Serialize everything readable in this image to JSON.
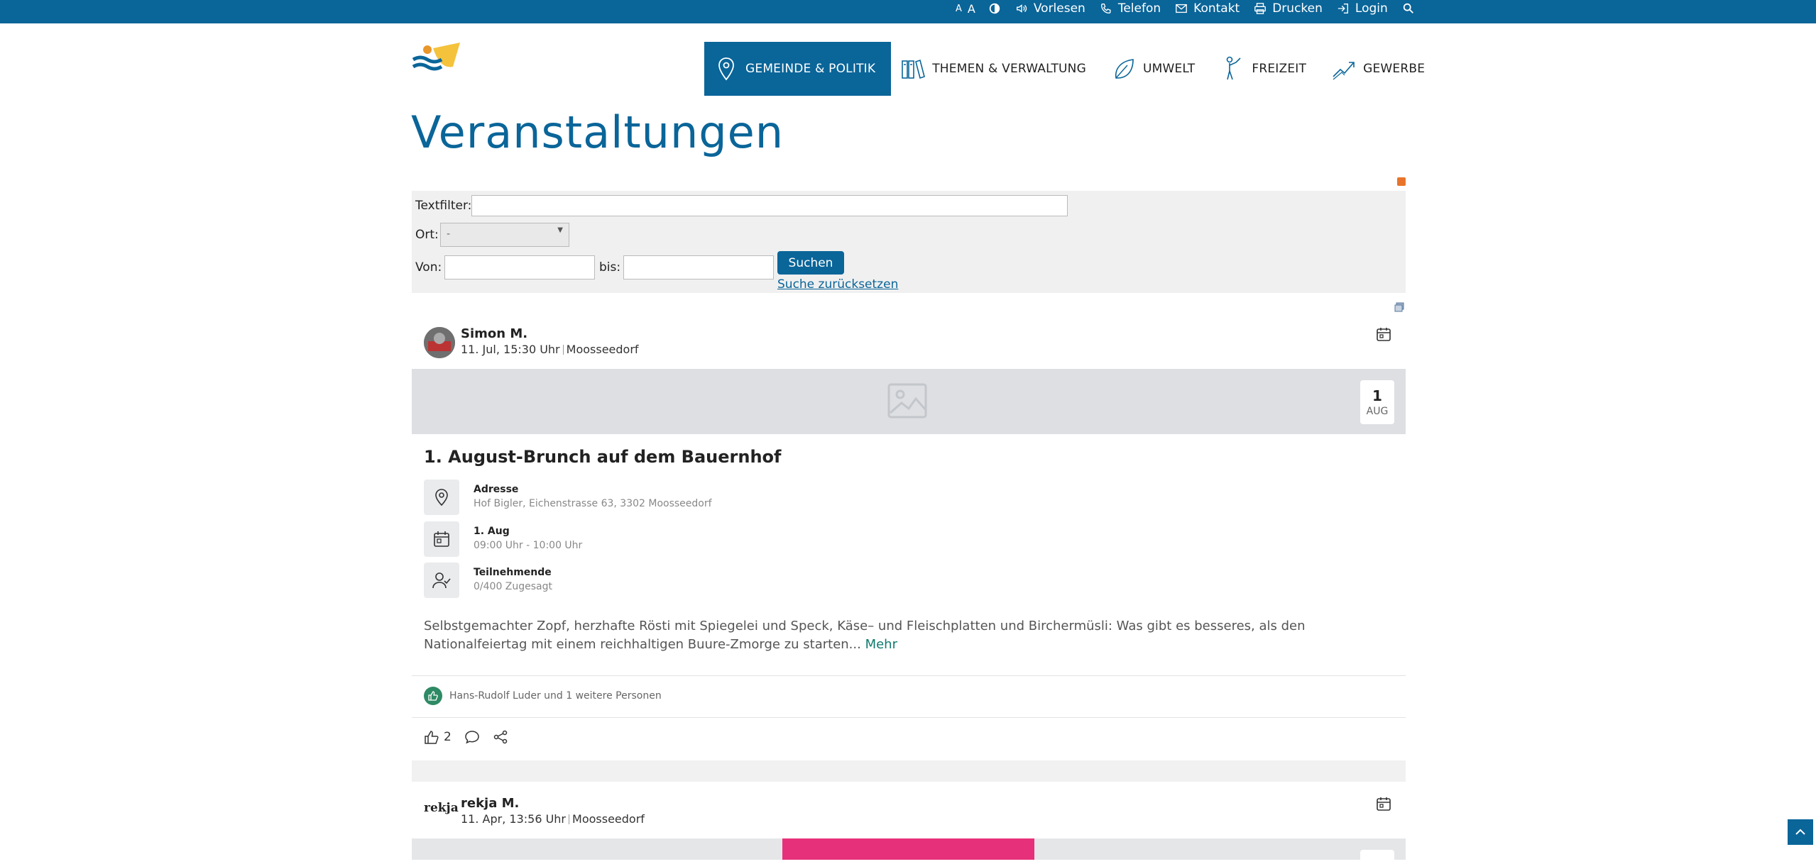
{
  "topbar": {
    "font_small": "A",
    "font_big": "A",
    "read_aloud": "Vorlesen",
    "phone": "Telefon",
    "contact": "Kontakt",
    "print": "Drucken",
    "login": "Login"
  },
  "nav": {
    "items": [
      {
        "label": "GEMEINDE & POLITIK",
        "icon": "location-pin-icon",
        "active": true
      },
      {
        "label": "THEMEN & VERWALTUNG",
        "icon": "books-icon",
        "active": false
      },
      {
        "label": "UMWELT",
        "icon": "leaf-icon",
        "active": false
      },
      {
        "label": "FREIZEIT",
        "icon": "person-icon",
        "active": false
      },
      {
        "label": "GEWERBE",
        "icon": "chart-trend-icon",
        "active": false
      }
    ]
  },
  "page": {
    "title": "Veranstaltungen"
  },
  "filter": {
    "text_label": "Textfilter:",
    "text_value": "",
    "location_label": "Ort:",
    "location_value": "-",
    "from_label": "Von:",
    "from_value": "",
    "to_label": "bis:",
    "to_value": "",
    "search_button": "Suchen",
    "reset_link": "Suche zurücksetzen"
  },
  "events": [
    {
      "author": "Simon M.",
      "posted": "11. Jul, 15:30 Uhr",
      "place": "Moosseedorf",
      "badge_day": "1",
      "badge_month": "AUG",
      "title": "1. August-Brunch auf dem Bauernhof",
      "address_label": "Adresse",
      "address_value": "Hof Bigler, Eichenstrasse 63, 3302 Moosseedorf",
      "date_label": "1. Aug",
      "date_value": "09:00 Uhr - 10:00 Uhr",
      "participants_label": "Teilnehmende",
      "participants_value": "0/400 Zugesagt",
      "description": "Selbstgemachter Zopf, herzhafte Rösti mit Spiegelei und Speck, Käse– und Fleischplatten und Birchermüsli: Was gibt es besseres, als den Nationalfeiertag mit einem reichhaltigen Buure-Zmorge zu starten...",
      "more": "Mehr",
      "likers": "Hans-Rudolf Luder und 1 weitere Personen",
      "like_count": "2"
    },
    {
      "author": "rekja M.",
      "logo_text": "rekja",
      "posted": "11. Apr, 13:56 Uhr",
      "place": "Moosseedorf"
    }
  ],
  "colors": {
    "primary": "#0a6599",
    "accent_green": "#2e8a64",
    "more_link": "#0f7a6f"
  }
}
